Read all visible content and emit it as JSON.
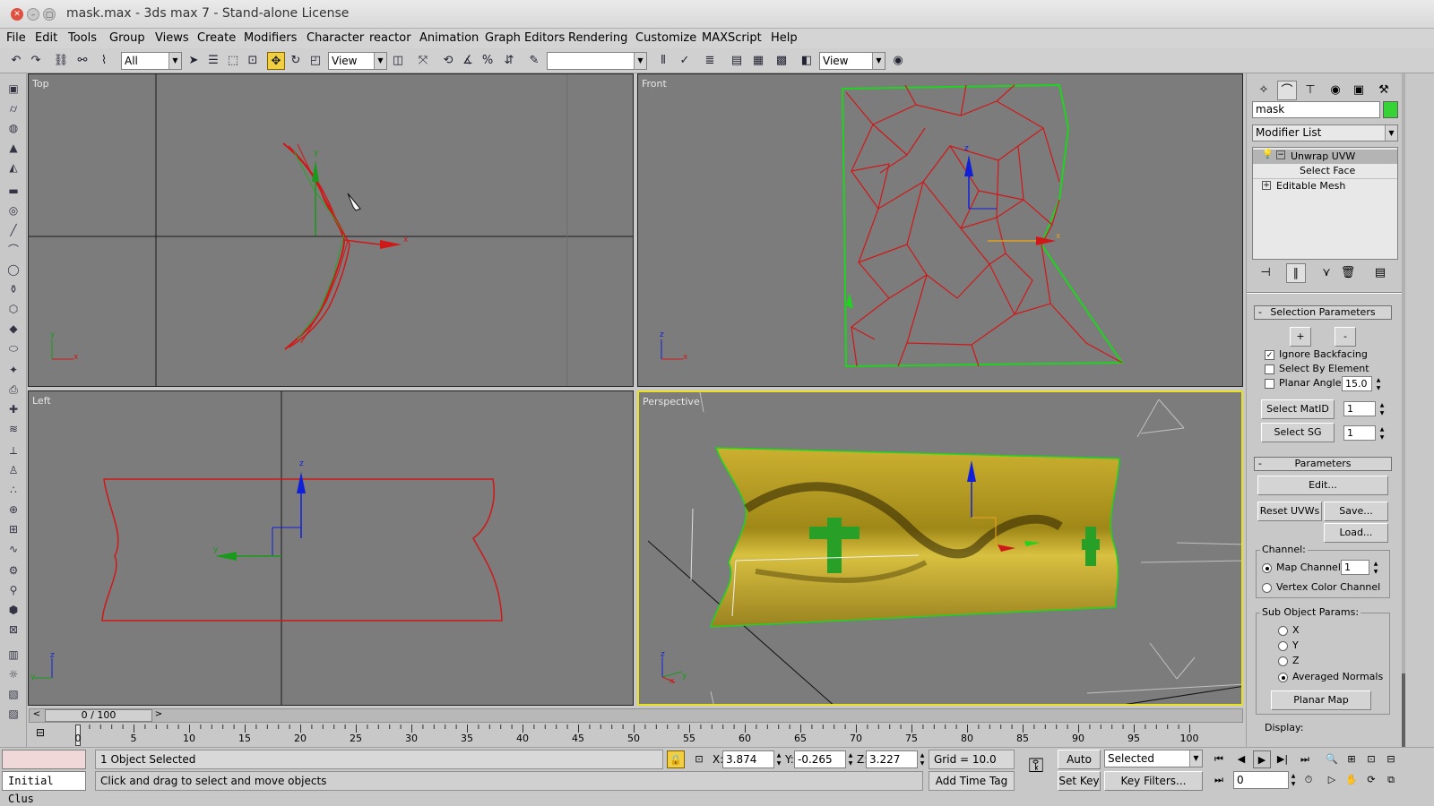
{
  "window": {
    "title": "mask.max - 3ds max 7  - Stand-alone License"
  },
  "menu": [
    "File",
    "Edit",
    "Tools",
    "Group",
    "Views",
    "Create",
    "Modifiers",
    "Character",
    "reactor",
    "Animation",
    "Graph Editors",
    "Rendering",
    "Customize",
    "MAXScript",
    "Help"
  ],
  "toolbar": {
    "selection_filter": "All",
    "ref_coord_1": "View",
    "named_selection": "",
    "ref_coord_2": "View"
  },
  "viewports": {
    "top": {
      "label": "Top",
      "axis1": "x",
      "axis2": "y",
      "gizmo_x": "x",
      "gizmo_y": "y"
    },
    "front": {
      "label": "Front",
      "axis1": "x",
      "axis2": "z",
      "gizmo_x": "x",
      "gizmo_z": "z"
    },
    "left": {
      "label": "Left",
      "axis1": "z",
      "axis2": "y",
      "gizmo_y": "y",
      "gizmo_z": "z"
    },
    "persp": {
      "label": "Perspective",
      "axis1": "z",
      "axis2": "y",
      "axis3": "x"
    }
  },
  "command_panel": {
    "object_name": "mask",
    "object_color": "#35d335",
    "modifier_list": "Modifier List",
    "stack": [
      {
        "label": "Unwrap UVW",
        "selected": true,
        "expand": "−"
      },
      {
        "label": "Select Face",
        "selected": false,
        "expand": ""
      },
      {
        "label": "Editable Mesh",
        "selected": false,
        "expand": "+"
      }
    ],
    "selection_params": {
      "title": "Selection Parameters",
      "plus": "+",
      "minus": "-",
      "ignore_backfacing": "Ignore Backfacing",
      "select_by_element": "Select By Element",
      "planar_angle": "Planar Angle",
      "planar_angle_value": "15.0",
      "select_matid": "Select MatID",
      "matid_value": "1",
      "select_sg": "Select SG",
      "sg_value": "1"
    },
    "parameters": {
      "title": "Parameters",
      "edit": "Edit...",
      "reset_uvws": "Reset UVWs",
      "save": "Save...",
      "load": "Load...",
      "channel_group": "Channel:",
      "map_channel": "Map Channel:",
      "map_channel_value": "1",
      "vertex_color_channel": "Vertex Color Channel",
      "sub_object_params": "Sub Object Params:",
      "opt_x": "X",
      "opt_y": "Y",
      "opt_z": "Z",
      "averaged_normals": "Averaged Normals",
      "planar_map": "Planar Map",
      "display": "Display:"
    }
  },
  "time": {
    "frame_readout": "0 / 100",
    "prev": "<",
    "next": ">",
    "ticks": [
      "0",
      "5",
      "10",
      "15",
      "20",
      "25",
      "30",
      "35",
      "40",
      "45",
      "50",
      "55",
      "60",
      "65",
      "70",
      "75",
      "80",
      "85",
      "90",
      "95",
      "100"
    ]
  },
  "status": {
    "script_label": "Initial Clus",
    "selection": "1 Object Selected",
    "prompt": "Click and drag to select and move objects",
    "x_label": "X:",
    "x": "3.874",
    "y_label": "Y:",
    "y": "-0.265",
    "z_label": "Z:",
    "z": "3.227",
    "grid": "Grid = 10.0",
    "add_time_tag": "Add Time Tag",
    "auto_key": "Auto Key",
    "set_key": "Set Key",
    "key_mode": "Selected",
    "key_filters": "Key Filters...",
    "current_frame": "0"
  }
}
